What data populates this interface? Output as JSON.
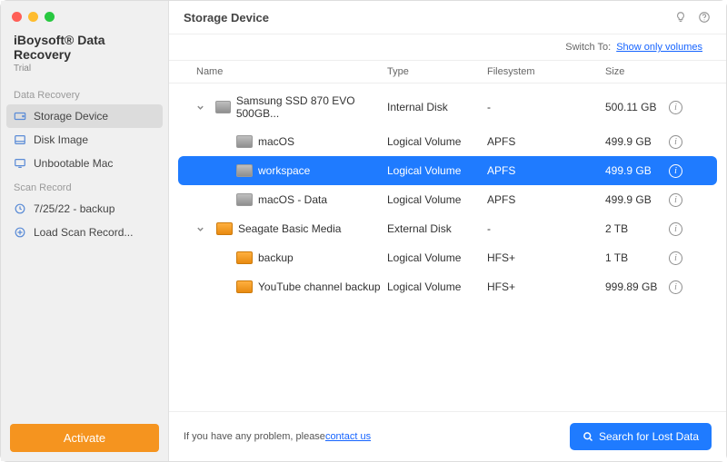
{
  "brand": {
    "name": "iBoysoft® Data Recovery",
    "sub": "Trial"
  },
  "sidebar": {
    "section1": "Data Recovery",
    "items1": [
      {
        "label": "Storage Device"
      },
      {
        "label": "Disk Image"
      },
      {
        "label": "Unbootable Mac"
      }
    ],
    "section2": "Scan Record",
    "items2": [
      {
        "label": "7/25/22 - backup"
      },
      {
        "label": "Load Scan Record..."
      }
    ],
    "activate": "Activate"
  },
  "title": "Storage Device",
  "switch": {
    "label": "Switch To:",
    "link": "Show only volumes"
  },
  "columns": {
    "name": "Name",
    "type": "Type",
    "fs": "Filesystem",
    "size": "Size"
  },
  "rows": [
    {
      "indent": 0,
      "expander": "v",
      "icon": "internal",
      "name": "Samsung SSD 870 EVO 500GB...",
      "type": "Internal Disk",
      "fs": "-",
      "size": "500.11 GB",
      "selected": false
    },
    {
      "indent": 1,
      "expander": "",
      "icon": "internal",
      "name": "macOS",
      "type": "Logical Volume",
      "fs": "APFS",
      "size": "499.9 GB",
      "selected": false
    },
    {
      "indent": 1,
      "expander": "",
      "icon": "internal",
      "name": "workspace",
      "type": "Logical Volume",
      "fs": "APFS",
      "size": "499.9 GB",
      "selected": true
    },
    {
      "indent": 1,
      "expander": "",
      "icon": "internal",
      "name": "macOS - Data",
      "type": "Logical Volume",
      "fs": "APFS",
      "size": "499.9 GB",
      "selected": false
    },
    {
      "indent": 0,
      "expander": "v",
      "icon": "orange",
      "name": "Seagate Basic Media",
      "type": "External Disk",
      "fs": "-",
      "size": "2 TB",
      "selected": false
    },
    {
      "indent": 1,
      "expander": "",
      "icon": "orange",
      "name": "backup",
      "type": "Logical Volume",
      "fs": "HFS+",
      "size": "1 TB",
      "selected": false
    },
    {
      "indent": 1,
      "expander": "",
      "icon": "orange",
      "name": "YouTube channel backup",
      "type": "Logical Volume",
      "fs": "HFS+",
      "size": "999.89 GB",
      "selected": false
    }
  ],
  "footer": {
    "text": "If you have any problem, please ",
    "link": "contact us"
  },
  "search": "Search for Lost Data"
}
